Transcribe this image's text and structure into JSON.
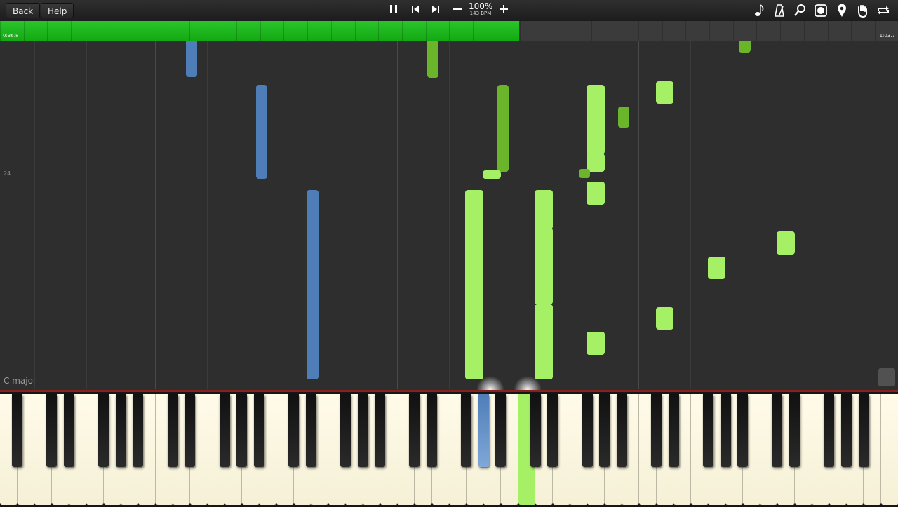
{
  "toolbar": {
    "back_label": "Back",
    "help_label": "Help",
    "speed_percent": "100%",
    "bpm": "143 BPM",
    "icons": [
      "pause-icon",
      "previous-icon",
      "next-icon",
      "minus-icon",
      "plus-icon",
      "note-icon",
      "metronome-icon",
      "key-search-icon",
      "label-icon",
      "marker-icon",
      "hand-icon",
      "loop-icon"
    ]
  },
  "progress": {
    "current_time": "0:36.8",
    "total_time": "1:03.7",
    "fraction": 0.578,
    "color": "#1ab81a"
  },
  "roll": {
    "measure_label": "24",
    "key_signature": "C major"
  },
  "colors": {
    "left_hand": "#4f7db8",
    "right_hand_light": "#a6f065",
    "right_hand_dark": "#6bb52a",
    "accent_line": "#8a1f1f"
  }
}
